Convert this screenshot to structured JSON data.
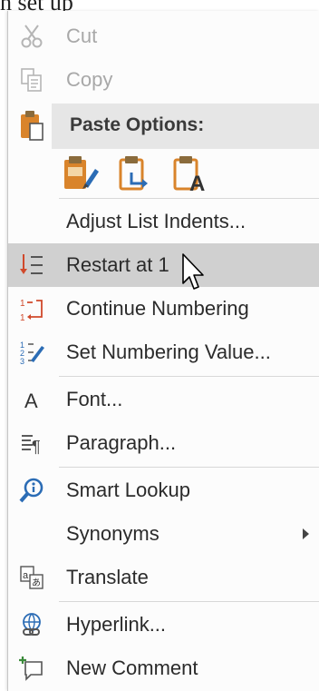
{
  "document": {
    "text_fragment": "n set up"
  },
  "menu": {
    "cut_label": "Cut",
    "copy_label": "Copy",
    "paste_options_label": "Paste Options:",
    "paste_buttons": [
      "keep-source-formatting",
      "merge-formatting",
      "keep-text-only"
    ],
    "adjust_list_indents_label": "Adjust List Indents...",
    "restart_at_1_label": "Restart at 1",
    "continue_numbering_label": "Continue Numbering",
    "set_numbering_value_label": "Set Numbering Value...",
    "font_label": "Font...",
    "paragraph_label": "Paragraph...",
    "smart_lookup_label": "Smart Lookup",
    "synonyms_label": "Synonyms",
    "translate_label": "Translate",
    "hyperlink_label": "Hyperlink...",
    "new_comment_label": "New Comment",
    "hovered_item": "Restart at 1"
  },
  "colors": {
    "accent_orange": "#d9842b",
    "accent_blue": "#2b6cb5",
    "hover_bg": "#d0d0d0",
    "disabled_text": "#a8a8a8"
  }
}
